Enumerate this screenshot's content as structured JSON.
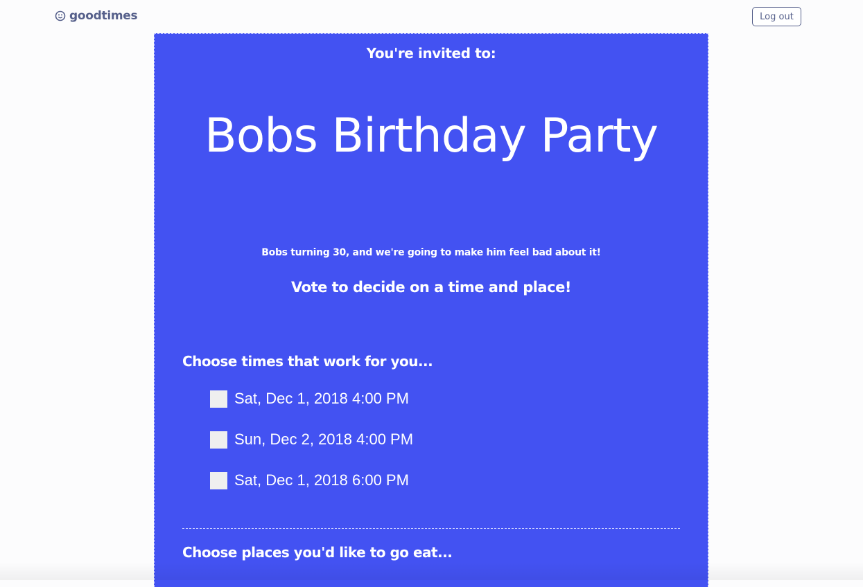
{
  "header": {
    "brand_name": "goodtimes",
    "brand_icon": "smiley-icon",
    "logout_label": "Log out"
  },
  "invite": {
    "intro": "You're invited to:",
    "title": "Bobs Birthday Party",
    "description": "Bobs turning 30, and we're going to make him feel bad about it!",
    "cta": "Vote to decide on a time and place!"
  },
  "times": {
    "heading": "Choose times that work for you...",
    "options": [
      {
        "label": "Sat, Dec 1, 2018 4:00 PM",
        "checked": false
      },
      {
        "label": "Sun, Dec 2, 2018 4:00 PM",
        "checked": false
      },
      {
        "label": "Sat, Dec 1, 2018 6:00 PM",
        "checked": false
      }
    ]
  },
  "places": {
    "heading": "Choose places you'd like to go eat..."
  },
  "colors": {
    "card_background": "#4352f2",
    "brand_text": "#56608b",
    "checkbox_fill": "#efefef"
  }
}
